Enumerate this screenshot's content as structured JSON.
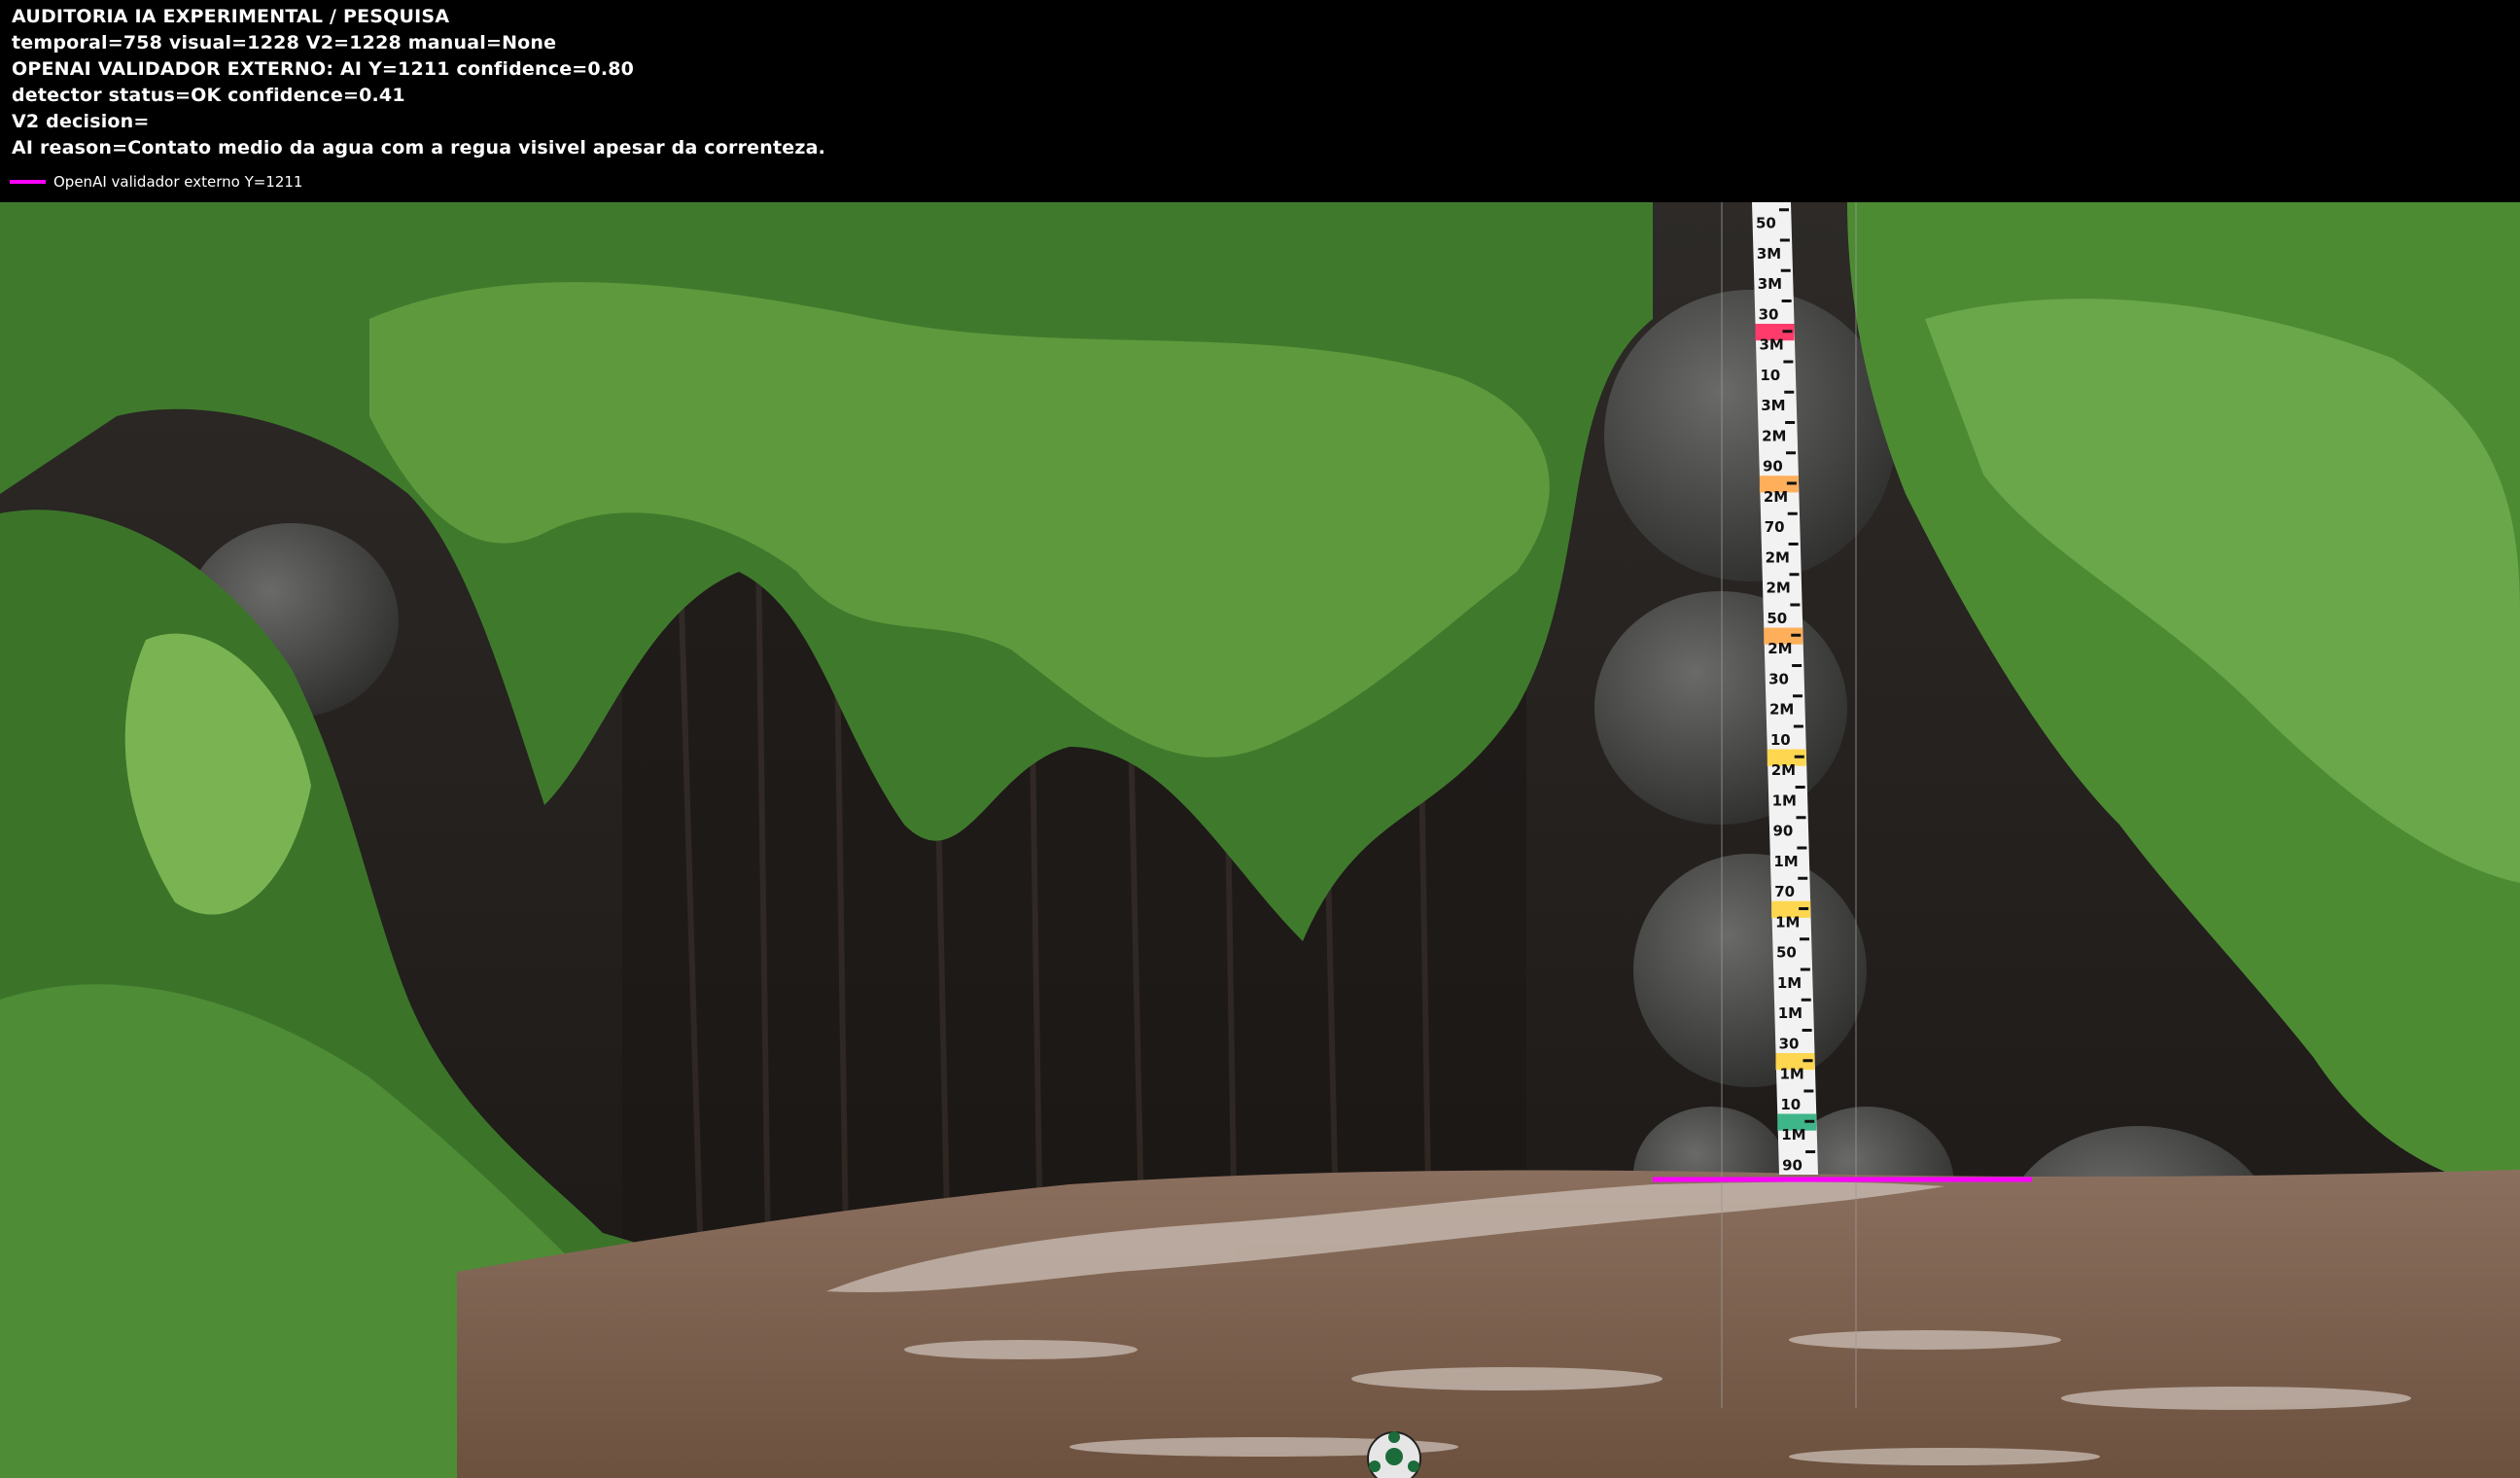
{
  "header": {
    "title": "AUDITORIA IA  EXPERIMENTAL / PESQUISA",
    "line1": "temporal=758  visual=1228  V2=1228  manual=None",
    "line2": "OPENAI  VALIDADOR EXTERNO: AI Y=1211  confidence=0.80",
    "line3": "detector status=OK confidence=0.41",
    "line4": "V2 decision=",
    "line5": "AI reason=Contato medio da agua com a regua visivel apesar da correnteza."
  },
  "legend": {
    "label": "OpenAI validador externo Y=1211",
    "color": "#ff00ff"
  },
  "gauge": {
    "labels": [
      "50",
      "3M",
      "3M",
      "30",
      "3M",
      "10",
      "3M",
      "2M",
      "90",
      "2M",
      "70",
      "2M",
      "2M",
      "50",
      "2M",
      "30",
      "2M",
      "10",
      "2M",
      "1M",
      "90",
      "1M",
      "70",
      "1M",
      "50",
      "1M",
      "1M",
      "30",
      "1M",
      "10",
      "1M",
      "90"
    ]
  },
  "colors": {
    "water": "#7a5e4d",
    "foliage": "#4f8a35",
    "rock": "#3c3c3c",
    "marker_line": "#ff00ff"
  },
  "icons": {
    "ball": "soccer-ball-icon"
  }
}
